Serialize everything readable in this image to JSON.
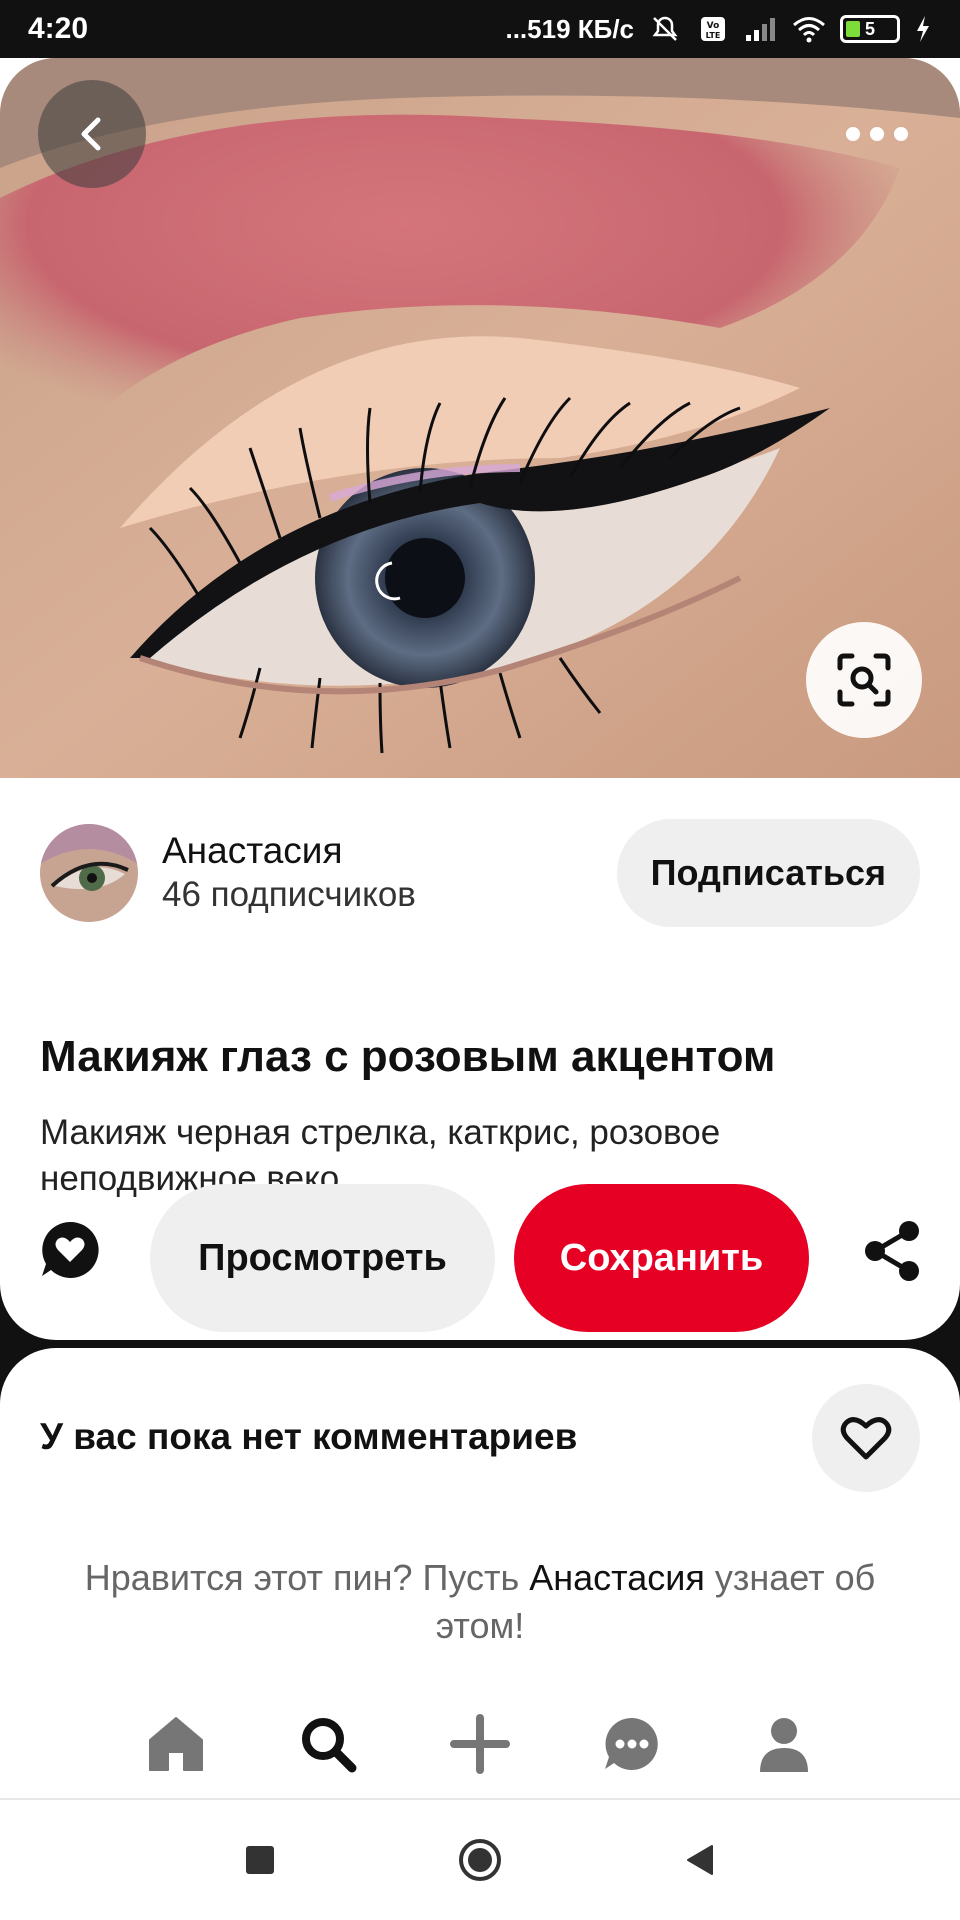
{
  "status_bar": {
    "time": "4:20",
    "network_speed": "...519 КБ/с",
    "battery_level": "5",
    "icons": [
      "dnd-off-icon",
      "volte-icon",
      "signal-icon",
      "wifi-icon",
      "battery-icon",
      "charging-icon"
    ]
  },
  "pin": {
    "image_description_icon": "eye-makeup-photo",
    "author": {
      "name": "Анастасия",
      "followers": "46 подписчиков",
      "follow_label": "Подписаться"
    },
    "title": "Макияж глаз с розовым акцентом",
    "description": "Макияж черная стрелка, каткрис, розовое неподвижное веко",
    "actions": {
      "view_label": "Просмотреть",
      "save_label": "Сохранить"
    }
  },
  "comments": {
    "heading": "У вас пока нет комментариев",
    "prompt_before": "Нравится этот пин? Пусть ",
    "prompt_name": "Анастасия",
    "prompt_after": " узнает об этом!"
  },
  "bottom_nav": {
    "items": [
      "home-icon",
      "search-icon",
      "add-icon",
      "messages-icon",
      "profile-icon"
    ],
    "active": "search-icon"
  },
  "colors": {
    "save_red": "#e60023",
    "button_grey": "#efefef",
    "nav_grey": "#767676"
  }
}
